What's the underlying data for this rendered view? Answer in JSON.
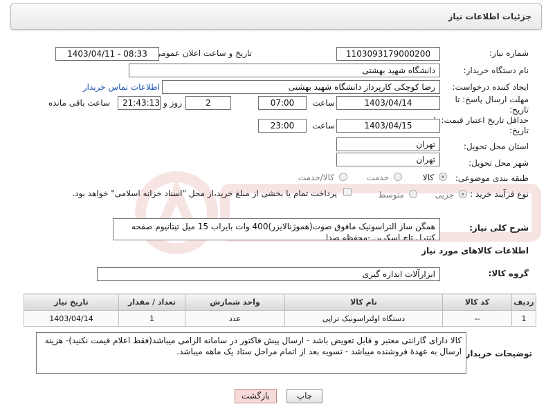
{
  "header": {
    "title": "جزئیات اطلاعات نیاز"
  },
  "form": {
    "need_number_label": "شماره نیاز:",
    "need_number_value": "1103093179000200",
    "announce_label": "تاریخ و ساعت اعلان عمومی:",
    "announce_value": "1403/04/11 - 08:33",
    "buyer_org_label": "نام دستگاه خریدار:",
    "buyer_org_value": "دانشگاه شهید بهشتی",
    "creator_label": "ایجاد کننده درخواست:",
    "creator_value": "رضا کوچکی کارپرداز دانشگاه شهید بهشتی",
    "contact_link": "اطلاعات تماس خریدار",
    "reply_deadline_label_1": "مهلت ارسال پاسخ: تا",
    "reply_deadline_label_2": "تاریخ:",
    "reply_date": "1403/04/14",
    "time_label": "ساعت",
    "reply_time": "07:00",
    "days_value": "2",
    "days_label": "روز و",
    "remaining_time": "21:43:13",
    "remaining_label": "ساعت باقی مانده",
    "price_validity_label_1": "حداقل تاریخ اعتبار قیمت: تا",
    "price_validity_label_2": "تاریخ:",
    "price_date": "1403/04/15",
    "price_time": "23:00",
    "province_label": "استان محل تحویل:",
    "province_value": "تهران",
    "city_label": "شهر محل تحویل:",
    "city_value": "تهران",
    "category_label": "طبقه بندی موضوعی:",
    "category_options": [
      "کالا",
      "خدمت",
      "کالا/خدمت"
    ],
    "purchase_type_label": "نوع فرآیند خرید :",
    "purchase_options": [
      "جزیی",
      "متوسط"
    ],
    "payment_note": "پرداخت تمام یا بخشی از مبلغ خرید،از محل \"اسناد خزانه اسلامی\" خواهد بود.",
    "description_label": "شرح کلی نیاز:",
    "description_value": "همگن ساز التراسونیک مافوق صوت(هموژنالایزر)400 وات بایراب 15 میل تیتانیوم صفحه کنترل تاچ اسکرین -محفظه صدا"
  },
  "goods": {
    "section_title": "اطلاعات کالاهای مورد نیاز",
    "group_label": "گروه کالا:",
    "group_value": "ابزارآلات اندازه گیری",
    "columns": [
      "ردیف",
      "کد کالا",
      "نام کالا",
      "واحد شمارش",
      "تعداد / مقدار",
      "تاریخ نیاز"
    ],
    "rows": [
      {
        "index": "1",
        "code": "--",
        "name": "دستگاه اولتراسونیک تراپی",
        "unit": "عدد",
        "qty": "1",
        "date": "1403/04/14"
      }
    ]
  },
  "buyer_notes": {
    "label": "توضیحات خریدار:",
    "text": "کالا دارای گارانتی معتبر و قابل تعویض باشد - ارسال پیش فاکتور در سامانه الزامی میباشد(فقط اعلام قیمت نکنید)- هزینه ارسال به عهدهٔ فروشنده میباشد - تسویه بعد از اتمام مراحل ستاد یک ماهه میباشد."
  },
  "buttons": {
    "print": "چاپ",
    "back": "بازگشت"
  },
  "colors": {
    "link": "#1a56b8",
    "back_button_bg": "#f7dada"
  },
  "icons": {
    "watermark": "aria-tender-logo"
  }
}
